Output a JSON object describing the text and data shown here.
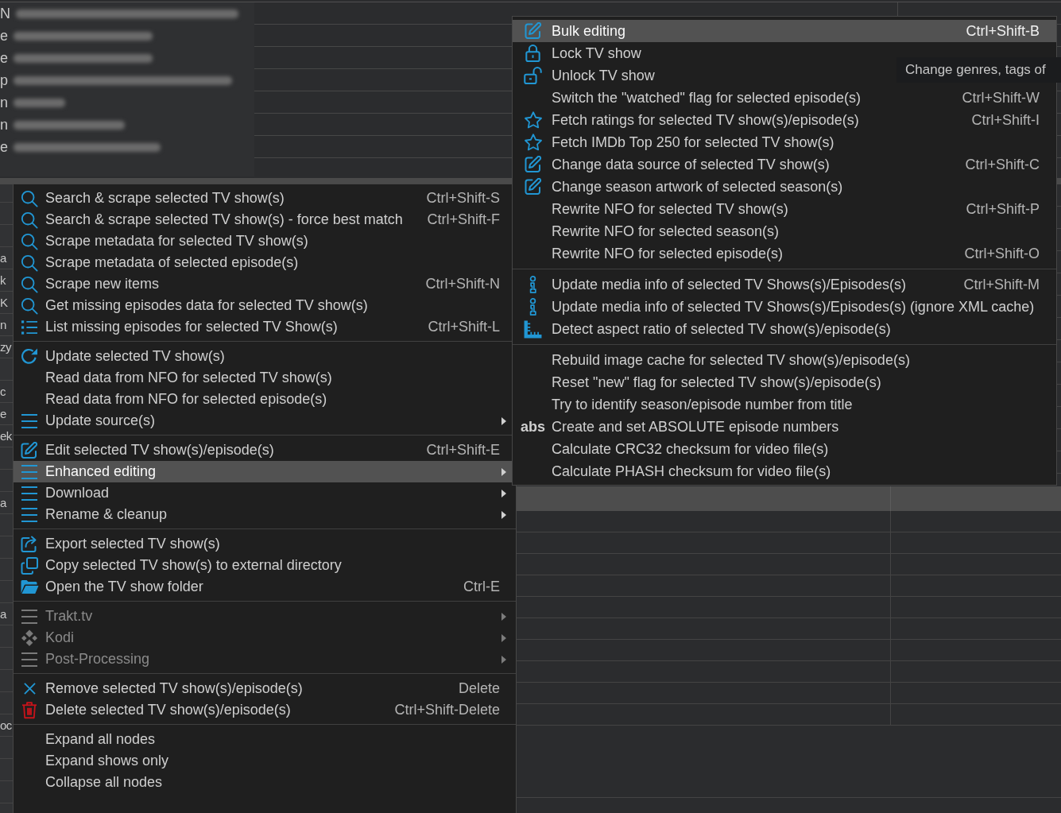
{
  "background": {
    "top_rows": [
      {
        "text": "N"
      },
      {
        "text": "e"
      },
      {
        "text": "e"
      },
      {
        "text": "p"
      },
      {
        "text": "n"
      },
      {
        "text": "n"
      },
      {
        "text": "e"
      }
    ],
    "side_rows": [
      {
        "text": "a"
      },
      {
        "text": "k"
      },
      {
        "text": "K"
      },
      {
        "text": "n"
      },
      {
        "text": "zy"
      },
      {
        "text": "c"
      },
      {
        "text": "e"
      },
      {
        "text": "ek"
      },
      {
        "text": "a"
      },
      {
        "text": "a"
      },
      {
        "text": "oc"
      }
    ]
  },
  "context_menu": {
    "sections": [
      {
        "items": [
          {
            "label": "Search & scrape selected TV show(s)",
            "kind": "scrape",
            "shortcut": "Ctrl+Shift-S",
            "submenu": false,
            "selected": false,
            "disabled": false
          },
          {
            "label": "Search & scrape selected TV show(s) - force best match",
            "kind": "scrape",
            "shortcut": "Ctrl+Shift-F",
            "submenu": false,
            "selected": false,
            "disabled": false
          },
          {
            "label": "Scrape metadata for selected TV show(s)",
            "kind": "scrape",
            "submenu": false,
            "selected": false,
            "disabled": false
          },
          {
            "label": "Scrape metadata of selected episode(s)",
            "kind": "scrape",
            "submenu": false,
            "selected": false,
            "disabled": false
          },
          {
            "label": "Scrape new items",
            "kind": "scrape",
            "shortcut": "Ctrl+Shift-N",
            "submenu": false,
            "selected": false,
            "disabled": false
          },
          {
            "label": "Get missing episodes data for selected TV show(s)",
            "kind": "scrape",
            "submenu": false,
            "selected": false,
            "disabled": false
          },
          {
            "label": "List missing episodes for selected TV Show(s)",
            "kind": "missing",
            "shortcut": "Ctrl+Shift-L",
            "submenu": false,
            "selected": false,
            "disabled": false
          }
        ]
      },
      {
        "items": [
          {
            "label": "Update selected TV show(s)",
            "kind": "update",
            "submenu": false,
            "selected": false,
            "disabled": false
          },
          {
            "label": "Read data from NFO for selected TV show(s)",
            "kind": "plain",
            "submenu": false,
            "selected": false,
            "disabled": false
          },
          {
            "label": "Read data from NFO for selected episode(s)",
            "kind": "plain",
            "submenu": false,
            "selected": false,
            "disabled": false
          },
          {
            "label": "Update source(s)",
            "kind": "group",
            "submenu": true,
            "selected": false,
            "disabled": false
          }
        ]
      },
      {
        "items": [
          {
            "label": "Edit selected TV show(s)/episode(s)",
            "kind": "edit",
            "shortcut": "Ctrl+Shift-E",
            "submenu": false,
            "selected": false,
            "disabled": false
          },
          {
            "label": "Enhanced editing",
            "kind": "group",
            "submenu": true,
            "selected": true,
            "disabled": false
          },
          {
            "label": "Download",
            "kind": "group",
            "submenu": true,
            "selected": false,
            "disabled": false
          },
          {
            "label": "Rename & cleanup",
            "kind": "group",
            "submenu": true,
            "selected": false,
            "disabled": false
          }
        ]
      },
      {
        "items": [
          {
            "label": "Export selected TV show(s)",
            "kind": "export",
            "submenu": false,
            "selected": false,
            "disabled": false
          },
          {
            "label": "Copy selected TV show(s) to external directory",
            "kind": "copy",
            "submenu": false,
            "selected": false,
            "disabled": false
          },
          {
            "label": "Open the TV show folder",
            "kind": "folder",
            "shortcut": "Ctrl-E",
            "submenu": false,
            "selected": false,
            "disabled": false
          }
        ]
      },
      {
        "items": [
          {
            "label": "Trakt.tv",
            "kind": "group",
            "submenu": true,
            "selected": false,
            "disabled": true
          },
          {
            "label": "Kodi",
            "kind": "kodi",
            "submenu": true,
            "selected": false,
            "disabled": true
          },
          {
            "label": "Post-Processing",
            "kind": "group",
            "submenu": true,
            "selected": false,
            "disabled": true
          }
        ]
      },
      {
        "items": [
          {
            "label": "Remove selected TV show(s)/episode(s)",
            "kind": "remove",
            "shortcut": "Delete",
            "submenu": false,
            "selected": false,
            "disabled": false
          },
          {
            "label": "Delete selected TV show(s)/episode(s)",
            "kind": "delete",
            "shortcut": "Ctrl+Shift-Delete",
            "submenu": false,
            "selected": false,
            "disabled": false
          }
        ]
      },
      {
        "items": [
          {
            "label": "Expand all nodes",
            "kind": "plain",
            "submenu": false,
            "selected": false,
            "disabled": false
          },
          {
            "label": "Expand shows only",
            "kind": "plain",
            "submenu": false,
            "selected": false,
            "disabled": false
          },
          {
            "label": "Collapse all nodes",
            "kind": "plain",
            "submenu": false,
            "selected": false,
            "disabled": false
          }
        ]
      }
    ]
  },
  "submenu": {
    "sections": [
      {
        "items": [
          {
            "label": "Bulk editing",
            "kind": "edit",
            "shortcut": "Ctrl+Shift-B",
            "selected": true
          },
          {
            "label": "Lock TV show",
            "kind": "lock",
            "selected": false
          },
          {
            "label": "Unlock TV show",
            "kind": "unlock",
            "selected": false
          },
          {
            "label": "Switch the \"watched\" flag for selected episode(s)",
            "kind": "plain",
            "shortcut": "Ctrl+Shift-W",
            "selected": false
          },
          {
            "label": "Fetch ratings for selected TV show(s)/episode(s)",
            "kind": "rating",
            "shortcut": "Ctrl+Shift-I",
            "selected": false
          },
          {
            "label": "Fetch IMDb Top 250 for selected TV show(s)",
            "kind": "rating",
            "selected": false
          },
          {
            "label": "Change data source of selected TV show(s)",
            "kind": "edit",
            "shortcut": "Ctrl+Shift-C",
            "selected": false
          },
          {
            "label": "Change season artwork of selected season(s)",
            "kind": "edit",
            "selected": false
          },
          {
            "label": "Rewrite NFO for selected TV show(s)",
            "kind": "plain",
            "shortcut": "Ctrl+Shift-P",
            "selected": false
          },
          {
            "label": "Rewrite NFO for selected season(s)",
            "kind": "plain",
            "selected": false
          },
          {
            "label": "Rewrite NFO for selected episode(s)",
            "kind": "plain",
            "shortcut": "Ctrl+Shift-O",
            "selected": false
          }
        ]
      },
      {
        "items": [
          {
            "label": "Update media info of selected TV Shows(s)/Episodes(s)",
            "kind": "mediainfo",
            "shortcut": "Ctrl+Shift-M",
            "selected": false
          },
          {
            "label": "Update media info of selected TV Shows(s)/Episodes(s) (ignore XML cache)",
            "kind": "mediainfo",
            "selected": false
          },
          {
            "label": "Detect aspect ratio of selected TV show(s)/episode(s)",
            "kind": "aspect",
            "selected": false
          }
        ]
      },
      {
        "items": [
          {
            "label": "Rebuild image cache for selected TV show(s)/episode(s)",
            "kind": "plain",
            "selected": false
          },
          {
            "label": "Reset \"new\" flag for selected TV show(s)/episode(s)",
            "kind": "plain",
            "selected": false
          },
          {
            "label": "Try to identify season/episode number from title",
            "kind": "plain",
            "selected": false
          },
          {
            "label": "Create and set ABSOLUTE episode numbers",
            "kind": "badge",
            "badge": "abs",
            "selected": false
          },
          {
            "label": "Calculate CRC32 checksum for video file(s)",
            "kind": "plain",
            "selected": false
          },
          {
            "label": "Calculate PHASH checksum for video file(s)",
            "kind": "plain",
            "selected": false
          }
        ]
      }
    ]
  },
  "tooltip": {
    "text": "Change genres, tags of"
  }
}
